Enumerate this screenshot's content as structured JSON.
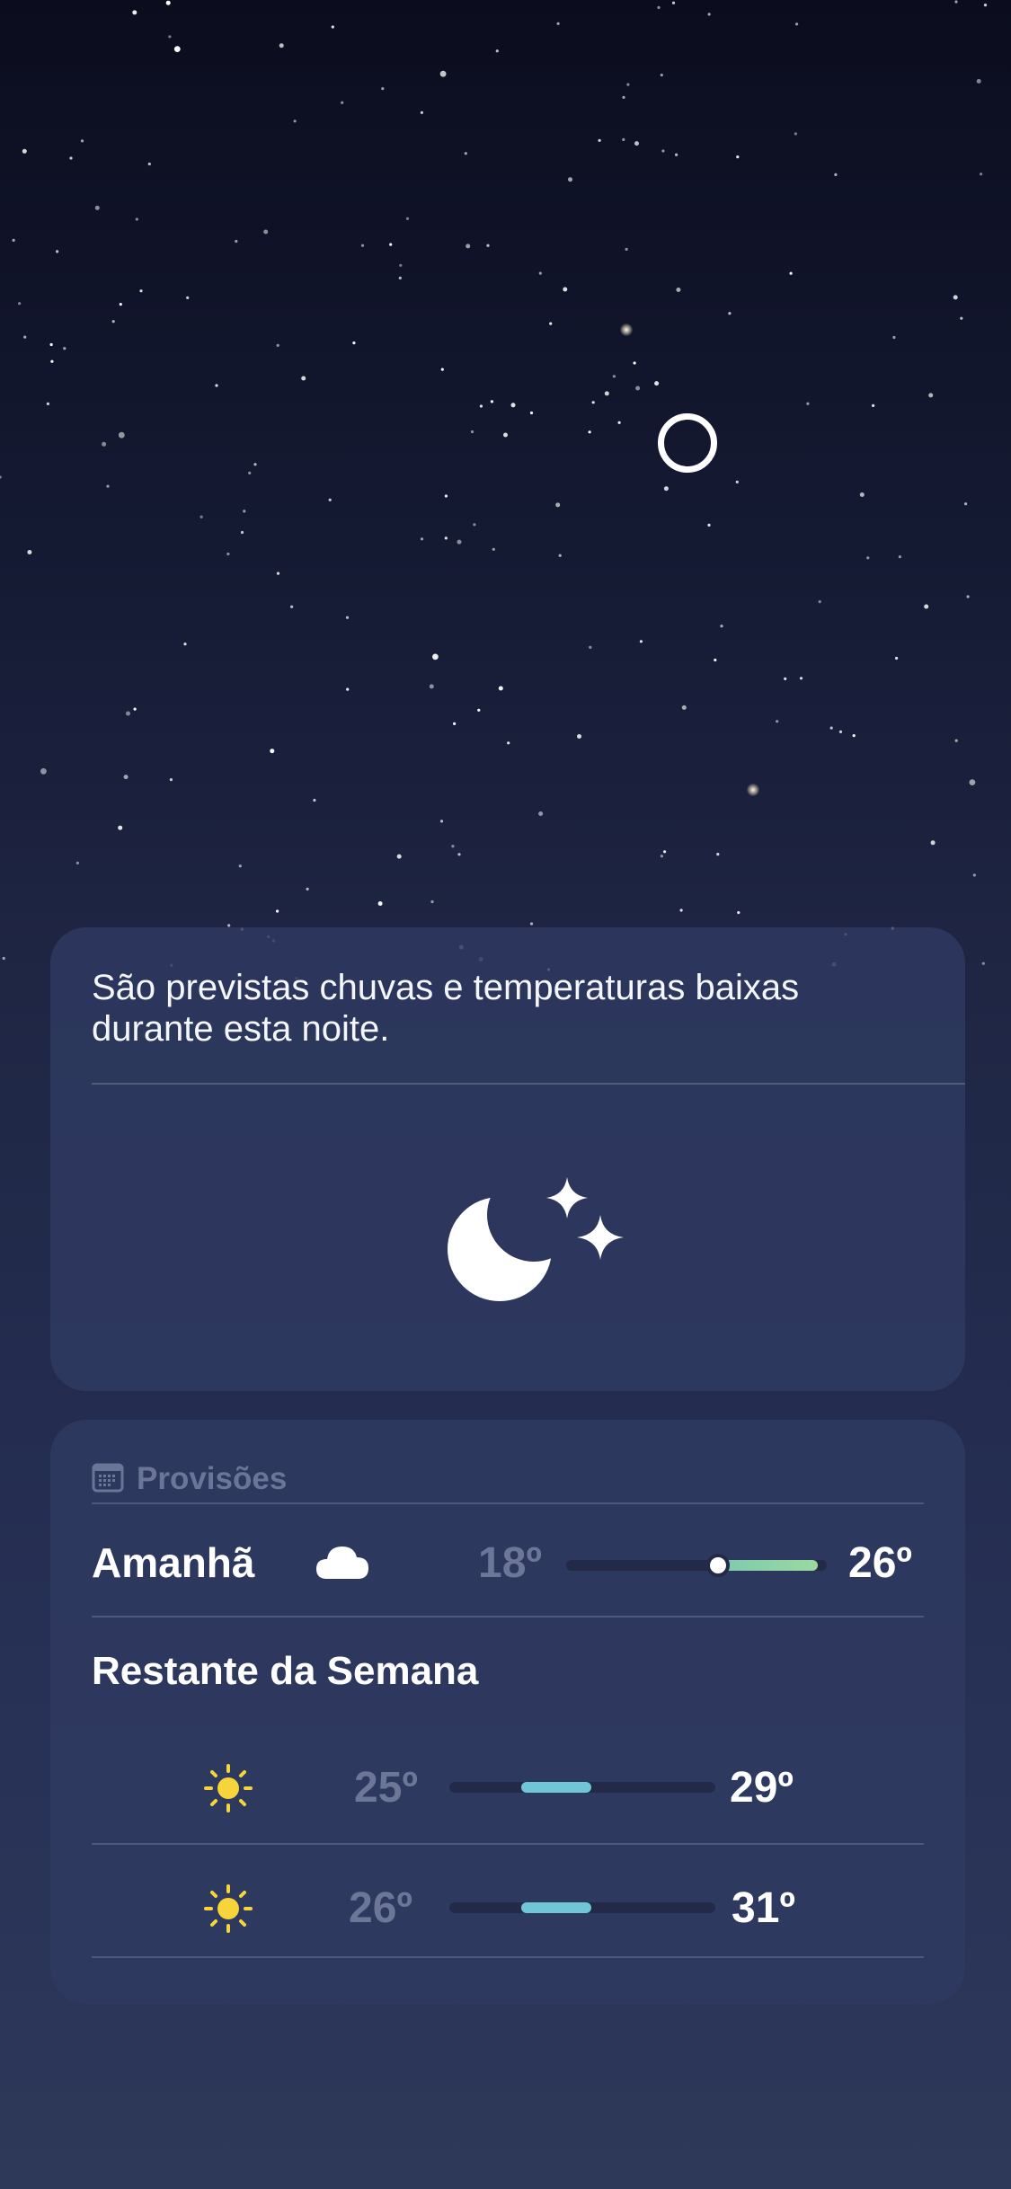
{
  "alert": {
    "text": "São previstas chuvas e temperaturas baixas durante esta noite.",
    "icon": "moon-stars-icon"
  },
  "forecast": {
    "header_label": "Provisões",
    "header_icon": "calendar-icon",
    "tomorrow": {
      "label": "Amanhã",
      "icon": "cloud-icon",
      "low": "18º",
      "high": "26º",
      "current_marker": true
    },
    "rest_of_week_title": "Restante da Semana",
    "days": [
      {
        "icon": "sun-icon",
        "low": "25º",
        "high": "29º"
      },
      {
        "icon": "sun-icon",
        "low": "26º",
        "high": "31º"
      }
    ]
  },
  "colors": {
    "bar_green": "#8fd39a",
    "bar_teal": "#6fc6d6",
    "sun": "#f7d43a",
    "text_muted": "#6c7697"
  }
}
